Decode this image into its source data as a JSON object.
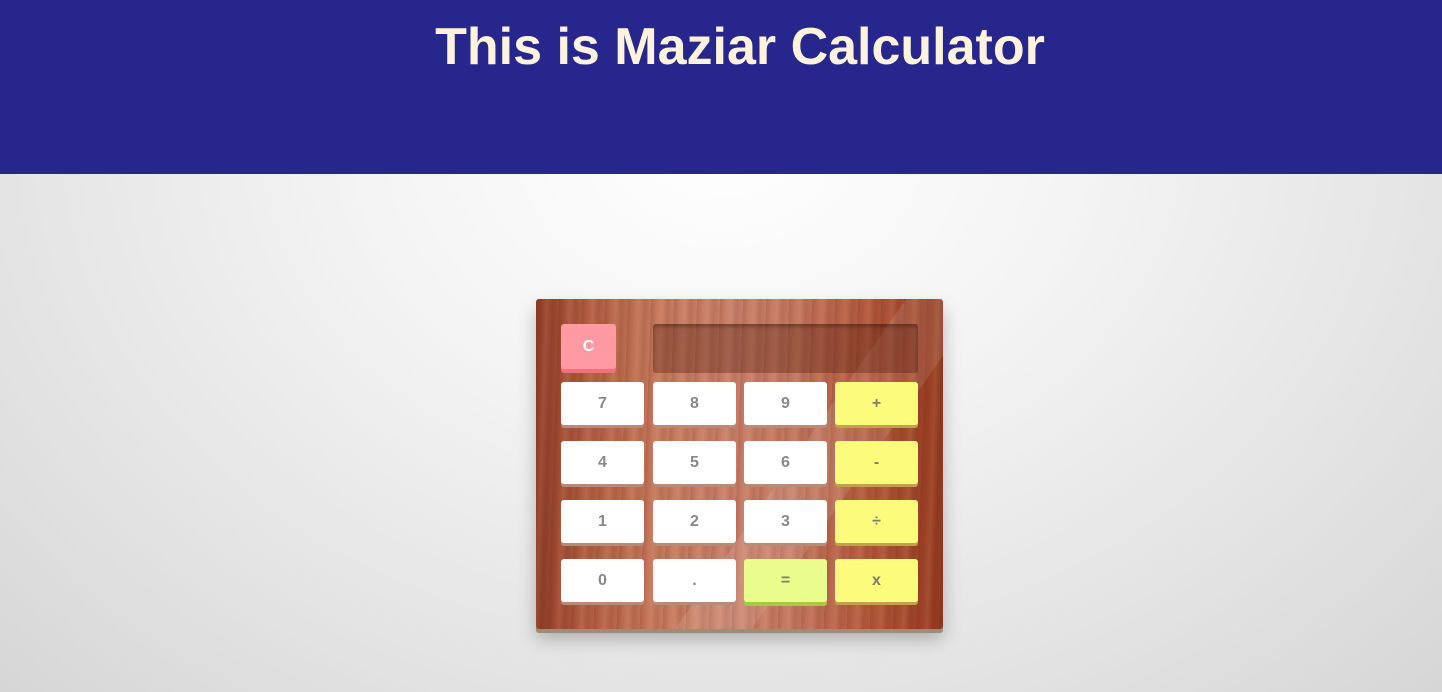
{
  "header": {
    "title": "This is Maziar Calculator",
    "background_color": "#27268c",
    "title_color": "#fdf3dc"
  },
  "calculator": {
    "display": "",
    "clear_label": "C",
    "keys": {
      "seven": "7",
      "eight": "8",
      "nine": "9",
      "plus": "+",
      "four": "4",
      "five": "5",
      "six": "6",
      "minus": "-",
      "one": "1",
      "two": "2",
      "three": "3",
      "divide": "÷",
      "zero": "0",
      "decimal": ".",
      "equals": "=",
      "multiply": "x"
    },
    "colors": {
      "number_key": "#ffffff",
      "operator_key": "#fdfb7c",
      "equals_key": "#eafc8c",
      "clear_key": "#ff9aa2"
    }
  }
}
